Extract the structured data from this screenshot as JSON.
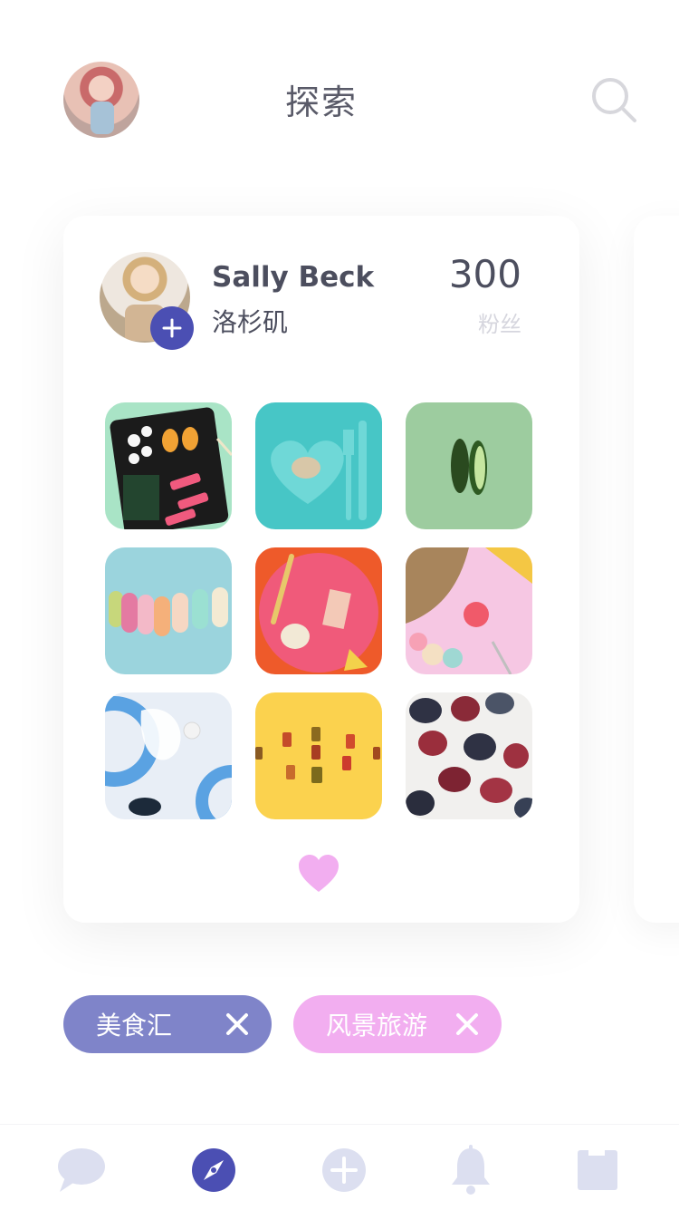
{
  "header": {
    "title": "探索",
    "avatar_icon": "user-avatar",
    "search_icon": "search-icon"
  },
  "profile": {
    "name": "Sally Beck",
    "location": "洛杉矶",
    "followers_count": "300",
    "followers_label": "粉丝",
    "follow_icon": "plus-icon"
  },
  "photos": [
    {
      "name": "sushi-bento"
    },
    {
      "name": "heart-plate-teal"
    },
    {
      "name": "cucumber-green"
    },
    {
      "name": "macarons-blue"
    },
    {
      "name": "pink-plate-orange"
    },
    {
      "name": "pink-table-snacks"
    },
    {
      "name": "blue-plates-white"
    },
    {
      "name": "jars-yellow"
    },
    {
      "name": "figs"
    }
  ],
  "tags": [
    {
      "label": "美食汇",
      "color": "#7f84c9"
    },
    {
      "label": "风景旅游",
      "color": "#f2aef0"
    }
  ],
  "tabbar": {
    "items": [
      "chat-icon",
      "compass-icon",
      "add-icon",
      "bell-icon",
      "bookmark-icon"
    ],
    "active": "compass-icon",
    "active_color": "#4b4fb3",
    "inactive_color": "#dcdff0"
  },
  "colors": {
    "accent": "#4b4fb3",
    "heart": "#f2aef0",
    "text": "#4c4e5e"
  }
}
